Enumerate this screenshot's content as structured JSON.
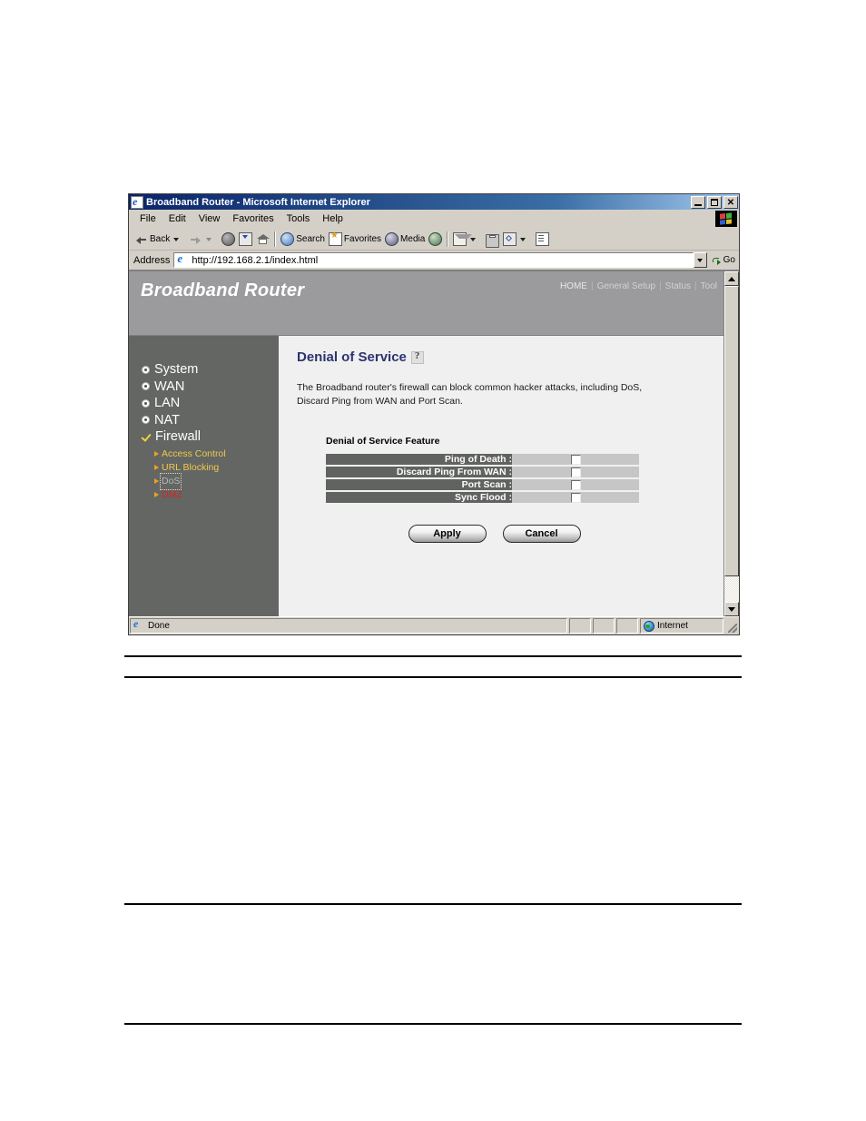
{
  "browser": {
    "title": "Broadband Router - Microsoft Internet Explorer",
    "window_controls": {
      "minimize": "_",
      "maximize": "□",
      "close": "✕"
    },
    "menus": [
      "File",
      "Edit",
      "View",
      "Favorites",
      "Tools",
      "Help"
    ],
    "toolbar": [
      {
        "icon": "back-arrow-icon",
        "label": "Back"
      },
      {
        "icon": "dropdown-caret-icon",
        "label": ""
      },
      {
        "icon": "forward-arrow-icon",
        "label": ""
      },
      {
        "icon": "dropdown-caret-icon",
        "label": ""
      },
      {
        "icon": "stop-icon",
        "label": ""
      },
      {
        "icon": "refresh-icon",
        "label": ""
      },
      {
        "icon": "home-icon",
        "label": ""
      },
      {
        "icon": "search-icon",
        "label": "Search"
      },
      {
        "icon": "favorites-star-icon",
        "label": "Favorites"
      },
      {
        "icon": "media-icon",
        "label": "Media"
      },
      {
        "icon": "history-icon",
        "label": ""
      },
      {
        "icon": "mail-icon",
        "label": ""
      },
      {
        "icon": "print-icon",
        "label": ""
      },
      {
        "icon": "edit-icon",
        "label": ""
      },
      {
        "icon": "discuss-icon",
        "label": ""
      }
    ],
    "address": {
      "label": "Address",
      "url": "http://192.168.2.1/index.html",
      "go_label": "Go"
    },
    "status": {
      "text": "Done",
      "zone": "Internet"
    }
  },
  "router": {
    "brand": "Broadband Router",
    "nav": [
      {
        "label": "HOME",
        "active": true
      },
      {
        "label": "General Setup",
        "active": false
      },
      {
        "label": "Status",
        "active": false
      },
      {
        "label": "Tool",
        "active": false
      }
    ],
    "nav_separator": "|",
    "sidebar": {
      "main_items": [
        {
          "label": "System",
          "icon": "bullet-dot-icon"
        },
        {
          "label": "WAN",
          "icon": "bullet-dot-icon"
        },
        {
          "label": "LAN",
          "icon": "bullet-dot-icon"
        },
        {
          "label": "NAT",
          "icon": "bullet-dot-icon"
        },
        {
          "label": "Firewall",
          "icon": "check-icon"
        }
      ],
      "sub_items": [
        {
          "label": "Access Control",
          "state": "normal"
        },
        {
          "label": "URL Blocking",
          "state": "normal"
        },
        {
          "label": "DoS",
          "state": "active"
        },
        {
          "label": "DMZ",
          "state": "highlight"
        }
      ]
    },
    "content": {
      "title": "Denial of Service",
      "help_icon": "question-mark-icon",
      "description": "The Broadband router's firewall can block common hacker attacks, including DoS, Discard Ping from WAN and Port Scan.",
      "section_label": "Denial of Service Feature",
      "rows": [
        {
          "label": "Ping of Death :",
          "checked": false
        },
        {
          "label": "Discard Ping From WAN :",
          "checked": false
        },
        {
          "label": "Port Scan :",
          "checked": false
        },
        {
          "label": "Sync Flood :",
          "checked": false
        }
      ],
      "buttons": {
        "apply": "Apply",
        "cancel": "Cancel"
      }
    }
  },
  "colors": {
    "header_band": "#9b9b9e",
    "sidebar_bg": "#636663",
    "row_label_bg": "#616360",
    "row_value_bg": "#c6c6c6",
    "title_blue": "#2b3470",
    "submenu_yellow": "#f2c84c",
    "dmz_red": "#e02020"
  }
}
